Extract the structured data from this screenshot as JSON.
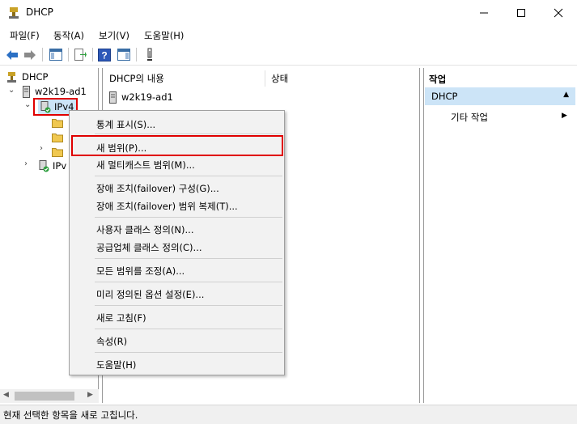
{
  "window": {
    "title": "DHCP",
    "minimize_icon": "minimize-icon",
    "maximize_icon": "maximize-icon",
    "close_icon": "close-icon"
  },
  "menu": {
    "file": "파일(F)",
    "action": "동작(A)",
    "view": "보기(V)",
    "help": "도움말(H)"
  },
  "tree": {
    "root": "DHCP",
    "server": "w2k19-ad1",
    "ipv4": "IPv4",
    "ipv6_partial": "IPv"
  },
  "content": {
    "col_name": "DHCP의 내용",
    "col_status": "상태",
    "row1": "w2k19-ad1"
  },
  "actions": {
    "title": "작업",
    "section": "DHCP",
    "more": "기타 작업"
  },
  "context_menu": {
    "show_stats": "통계 표시(S)...",
    "new_scope": "새 범위(P)...",
    "new_multicast": "새 멀티캐스트 범위(M)...",
    "failover_config": "장애 조치(failover) 구성(G)...",
    "failover_replicate": "장애 조치(failover) 범위 복제(T)...",
    "user_classes": "사용자 클래스 정의(N)...",
    "vendor_classes": "공급업체 클래스 정의(C)...",
    "reconcile": "모든 범위를 조정(A)...",
    "predefined_options": "미리 정의된 옵션 설정(E)...",
    "refresh": "새로 고침(F)",
    "properties": "속성(R)",
    "help": "도움말(H)"
  },
  "statusbar": {
    "text": "현재 선택한 항목을 새로 고칩니다."
  },
  "colors": {
    "highlight": "#e00000",
    "arrow": "#f07a10",
    "selection": "#cce4f7"
  }
}
